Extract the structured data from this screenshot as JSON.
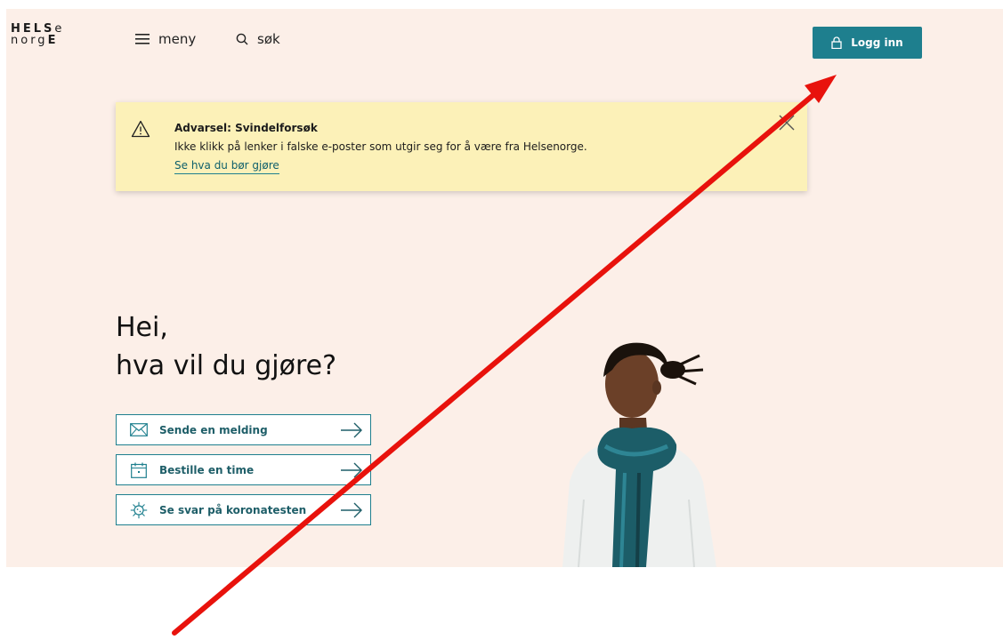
{
  "logo": {
    "row1_bold": "HELS",
    "row1_light": "e",
    "row2_light": "norg",
    "row2_bold": "E"
  },
  "nav": {
    "menu_label": "meny",
    "search_label": "søk",
    "login_label": "Logg inn"
  },
  "alert": {
    "title": "Advarsel: Svindelforsøk",
    "text": "Ikke klikk på lenker i falske e-poster som utgir seg for å være fra Helsenorge.",
    "link": "Se hva du bør gjøre"
  },
  "hero": {
    "line1": "Hei,",
    "line2": "hva vil du gjøre?"
  },
  "actions": [
    {
      "label": "Sende en melding",
      "icon": "envelope-icon"
    },
    {
      "label": "Bestille en time",
      "icon": "calendar-icon"
    },
    {
      "label": "Se svar på koronatesten",
      "icon": "virus-icon"
    }
  ],
  "colors": {
    "page_background": "#fcefe8",
    "accent": "#1e7f8e",
    "alert_background": "#fcf1b8",
    "annotation_arrow": "#e8120c"
  }
}
